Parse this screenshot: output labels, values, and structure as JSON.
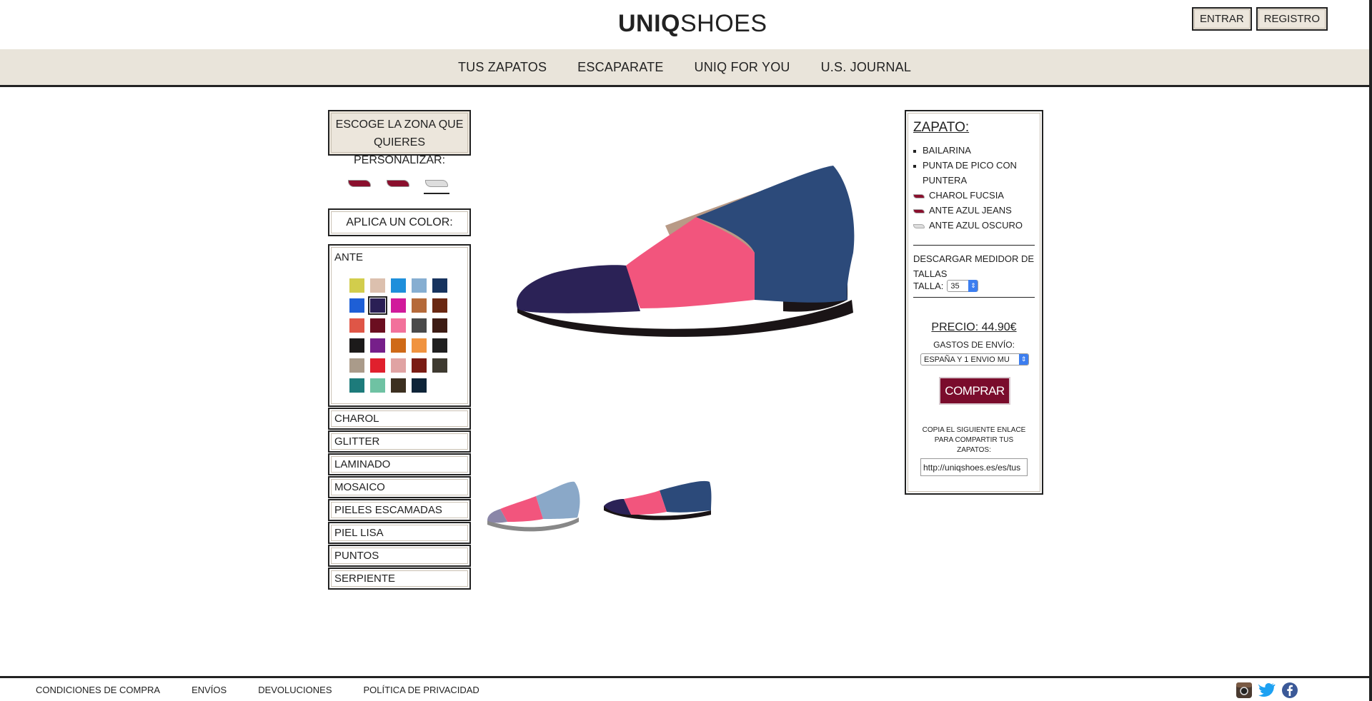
{
  "brand": {
    "bold": "UNIQ",
    "light": "SHOES"
  },
  "auth": {
    "login": "ENTRAR",
    "register": "REGISTRO"
  },
  "nav": [
    "TUS ZAPATOS",
    "ESCAPARATE",
    "UNIQ FOR YOU",
    "U.S. JOURNAL"
  ],
  "left": {
    "zone_title": "ESCOGE LA ZONA QUE QUIERES PERSONALIZAR:",
    "apply_title": "APLICA UN COLOR:",
    "open_material": "ANTE",
    "materials": [
      "CHAROL",
      "GLITTER",
      "LAMINADO",
      "MOSAICO",
      "PIELES ESCAMADAS",
      "PIEL LISA",
      "PUNTOS",
      "SERPIENTE"
    ]
  },
  "swatch_colors": [
    "#d2cd4c",
    "#dcc0ae",
    "#1e8fdb",
    "#86aed1",
    "#17335e",
    "#1e5fd6",
    "#2a1f55",
    "#d11a9b",
    "#b56a3a",
    "#6a2812",
    "#df5647",
    "#6b0e20",
    "#f2719b",
    "#4a4a4a",
    "#3d1c14",
    "#1c1a1a",
    "#761f8a",
    "#cf6a18",
    "#f09340",
    "#202020",
    "#aa9b8a",
    "#e0202d",
    "#e0a3a3",
    "#7a1c14",
    "#3e3a30",
    "#1d7b7b",
    "#6fc2a3",
    "#3c3020",
    "#0e2438"
  ],
  "selected_swatch": 6,
  "zone_thumb_colors": [
    "#8a0f2d",
    "#8a0f2d",
    "#dddddd"
  ],
  "panel": {
    "title": "ZAPATO:",
    "specs": [
      "BAILARINA",
      "PUNTA DE PICO CON PUNTERA"
    ],
    "parts": [
      {
        "label": "CHAROL FUCSIA",
        "color": "#8a0f2d"
      },
      {
        "label": "ANTE AZUL JEANS",
        "color": "#8a0f2d"
      },
      {
        "label": "ANTE AZUL OSCURO",
        "color": "#dddddd"
      }
    ],
    "download": "DESCARGAR MEDIDOR DE TALLAS",
    "size_label": "TALLA:",
    "size_value": "35",
    "price": "PRECIO: 44.90€",
    "shipping_label": "GASTOS DE ENVÍO:",
    "shipping_value": "ESPAÑA Y 1 ENVIO MU",
    "buy": "COMPRAR",
    "share_text": "COPIA EL SIGUIENTE ENLACE PARA COMPARTIR TUS ZAPATOS:",
    "share_link": "http://uniqshoes.es/es/tus"
  },
  "shoe_colors": {
    "toe": "#2b2256",
    "body": "#f2557d",
    "heel": "#2c4a7a",
    "sole": "#1a1416",
    "lining": "#b89a86"
  },
  "footer": [
    "CONDICIONES DE COMPRA",
    "ENVÍOS",
    "DEVOLUCIONES",
    "POLÍTICA DE PRIVACIDAD"
  ],
  "social_icons": [
    "instagram-icon",
    "twitter-icon",
    "facebook-icon"
  ]
}
